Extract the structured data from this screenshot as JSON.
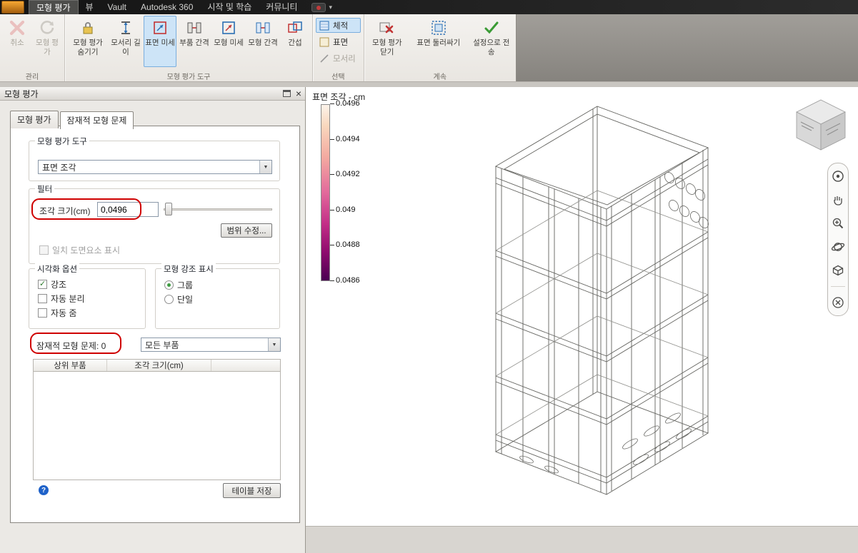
{
  "app": {
    "titlebar_tabs": [
      {
        "label": "모형 평가",
        "active": true
      },
      {
        "label": "뷰",
        "active": false
      },
      {
        "label": "Vault",
        "active": false
      },
      {
        "label": "Autodesk 360",
        "active": false
      },
      {
        "label": "시작 및 학습",
        "active": false
      },
      {
        "label": "커뮤니티",
        "active": false
      }
    ]
  },
  "ribbon": {
    "manage": {
      "group_label": "관리",
      "undo": "취소",
      "model_eval": "모형 평가"
    },
    "tools": {
      "group_label": "모형 평가 도구",
      "hide_eval": "모형 평가 숨기기",
      "edge_length": "모서리 길이",
      "surface_fine": "표면 미세",
      "part_gap": "부품 간격",
      "model_fine": "모형 미세",
      "model_gap": "모형 간격",
      "interference": "간섭"
    },
    "select": {
      "group_label": "선택",
      "volume": "체적",
      "surface": "표면",
      "edge": "모서리"
    },
    "continue": {
      "group_label": "계속",
      "close_eval": "모형 평가 닫기",
      "surface_wrap": "표면 둘러싸기",
      "send_settings": "설정으로 전송"
    }
  },
  "panel": {
    "title": "모형 평가",
    "tab_eval": "모형 평가",
    "tab_issues": "잠재적 모형 문제",
    "tool_group_label": "모형 평가 도구",
    "tool_dropdown_value": "표면 조각",
    "filter_group_label": "필터",
    "size_label": "조각 크기(cm)",
    "size_value": "0,0496",
    "range_button": "범위 수정...",
    "match_checkbox": "일치 도면요소 표시",
    "visual_group_label": "시각화 옵션",
    "visual_options": [
      {
        "label": "강조",
        "checked": true
      },
      {
        "label": "자동 분리",
        "checked": false
      },
      {
        "label": "자동 줌",
        "checked": false
      }
    ],
    "highlight_group_label": "모형 강조 표시",
    "highlight_options": [
      {
        "label": "그룹",
        "selected": true
      },
      {
        "label": "단일",
        "selected": false
      }
    ],
    "issues_label": "잠재적 모형 문제: 0",
    "parts_dropdown_value": "모든 부품",
    "table_headers": [
      "상위 부품",
      "조각 크기(cm)"
    ],
    "save_table_button": "테이블 저장"
  },
  "canvas": {
    "scale_title": "표면 조각 - cm",
    "scale_labels": [
      "0.0496",
      "0.0494",
      "0.0492",
      "0.049",
      "0.0488",
      "0.0486"
    ],
    "scale_gradient_top": "#fdf3ea",
    "scale_gradient_bottom": "#4a0052",
    "annotation_color": "#cf0000"
  },
  "icons": {
    "dropdown": "▼",
    "close": "×",
    "check": "✓",
    "help": "?"
  }
}
